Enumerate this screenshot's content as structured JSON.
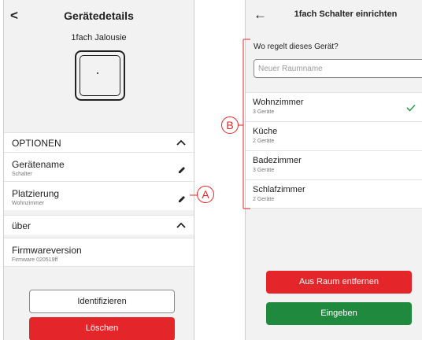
{
  "left_screen": {
    "back_glyph": "<",
    "title": "Gerätedetails",
    "device_name": "1fach Jalousie",
    "options_section": {
      "label": "OPTIONEN",
      "caret": "^"
    },
    "device_name_row": {
      "label": "Gerätename",
      "value": "Schalter"
    },
    "placement_row": {
      "label": "Platzierung",
      "value": "Wohnzimmer"
    },
    "about_section": {
      "label": "über",
      "caret": "^"
    },
    "firmware_row": {
      "label": "Firmwareversion",
      "value": "Firmware 020519ff"
    },
    "identify_button": "Identifizieren",
    "delete_button": "Löschen"
  },
  "right_screen": {
    "back_glyph": "←",
    "title": "1fach Schalter einrichten",
    "question": "Wo regelt dieses Gerät?",
    "room_input": {
      "placeholder": "Neuer Raumname",
      "value": ""
    },
    "rooms": [
      {
        "name": "Wohnzimmer",
        "count": "3 Geräte",
        "selected": true
      },
      {
        "name": "Küche",
        "count": "2 Geräte",
        "selected": false
      },
      {
        "name": "Badezimmer",
        "count": "3 Geräte",
        "selected": false
      },
      {
        "name": "Schlafzimmer",
        "count": "2 Geräte",
        "selected": false
      }
    ],
    "remove_button": "Aus Raum entfernen",
    "enter_button": "Eingeben"
  },
  "annotations": {
    "a": "A",
    "b": "B"
  },
  "colors": {
    "red": "#e4252a",
    "green": "#1f8a3d",
    "check": "#2e9e4f"
  },
  "icons": {
    "edit": "pencil-icon",
    "check": "checkmark-icon",
    "back_left": "chevron-left-icon",
    "back_right": "arrow-left-icon",
    "caret": "chevron-up-icon"
  }
}
